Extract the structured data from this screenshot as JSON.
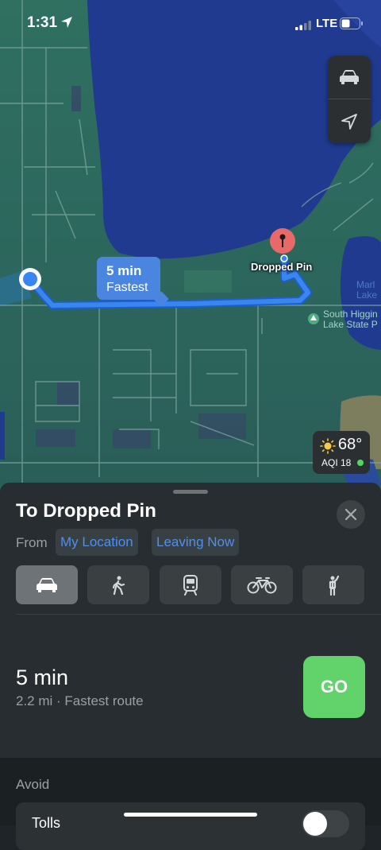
{
  "status_bar": {
    "time": "1:31",
    "network": "LTE",
    "icons": [
      "location-arrow-icon",
      "signal-icon",
      "battery-icon"
    ]
  },
  "map": {
    "controls": [
      "car-icon",
      "location-arrow-icon"
    ],
    "route_callout": {
      "time": "5 min",
      "label": "Fastest"
    },
    "destination_label": "Dropped Pin",
    "park_label_line1": "South Higgin",
    "park_label_line2": "Lake State P",
    "lake_label_line1": "Marl",
    "lake_label_line2": "Lake",
    "weather": {
      "temp": "68°",
      "aqi": "AQI 18",
      "icon": "sun-icon"
    }
  },
  "sheet": {
    "title": "To Dropped Pin",
    "from_label": "From",
    "from_value": "My Location",
    "time_option": "Leaving Now",
    "modes": [
      {
        "name": "drive",
        "icon": "car-icon",
        "selected": true
      },
      {
        "name": "walk",
        "icon": "walking-icon",
        "selected": false
      },
      {
        "name": "transit",
        "icon": "train-icon",
        "selected": false
      },
      {
        "name": "cycle",
        "icon": "bicycle-icon",
        "selected": false
      },
      {
        "name": "rideshare",
        "icon": "hail-icon",
        "selected": false
      }
    ],
    "route": {
      "time": "5 min",
      "details": "2.2 mi · Fastest route",
      "go_label": "GO"
    },
    "avoid": {
      "title": "Avoid",
      "tolls_label": "Tolls",
      "tolls_on": false
    }
  },
  "colors": {
    "accent": "#4d90ef",
    "go": "#62d26a",
    "route": "#3a86f0",
    "pin": "#e8696a",
    "water": "#1f3a8f",
    "land": "#2e6a5f"
  }
}
